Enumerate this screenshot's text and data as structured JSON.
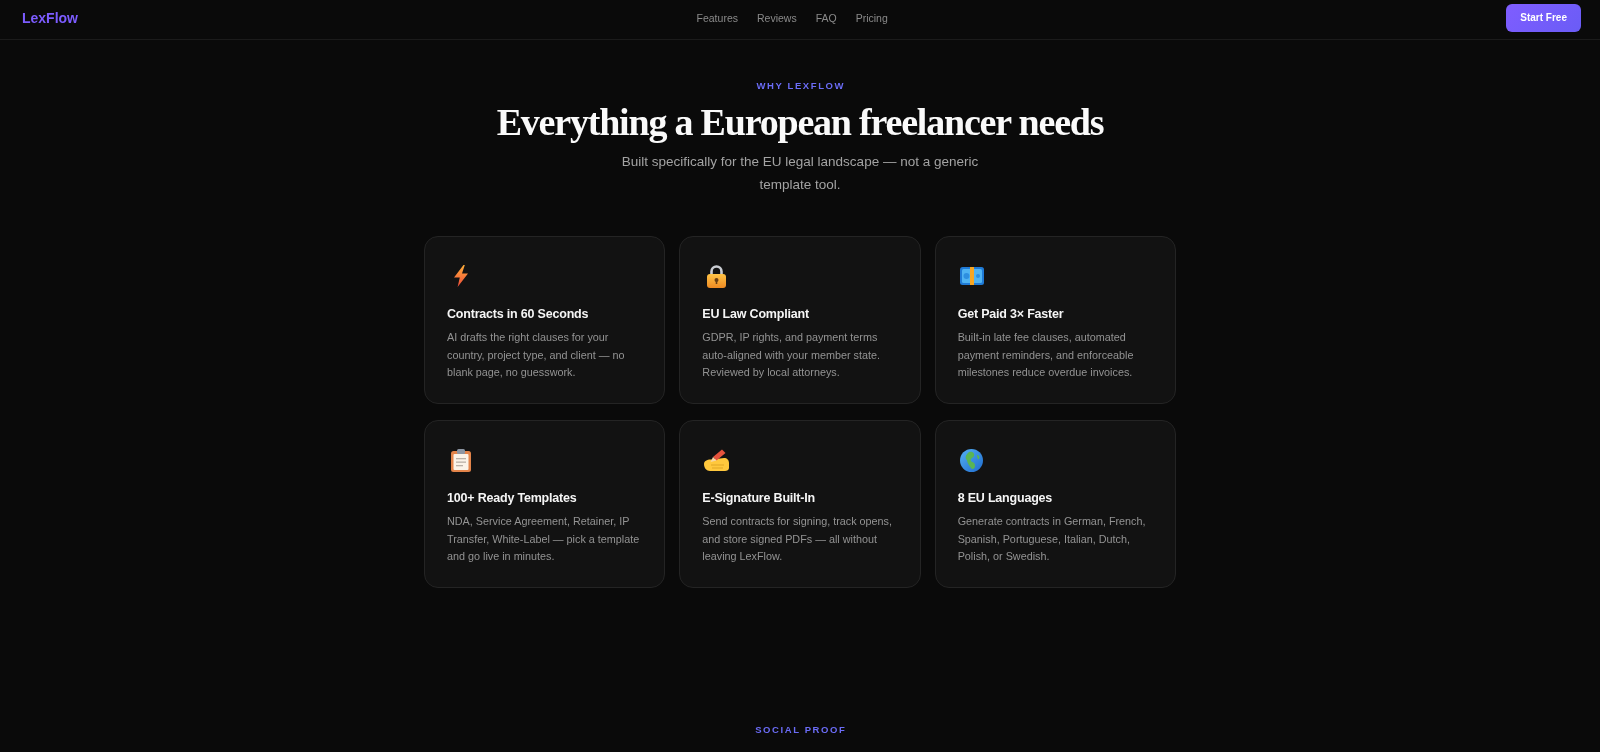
{
  "header": {
    "logo": "LexFlow",
    "nav": [
      "Features",
      "Reviews",
      "FAQ",
      "Pricing"
    ],
    "cta": "Start Free"
  },
  "features_section": {
    "eyebrow": "WHY LEXFLOW",
    "title": "Everything a European freelancer needs",
    "subtitle": "Built specifically for the EU legal landscape — not a generic template tool.",
    "cards": [
      {
        "title": "Contracts in 60 Seconds",
        "description": "AI drafts the right clauses for your country, project type, and client — no blank page, no guesswork."
      },
      {
        "title": "EU Law Compliant",
        "description": "GDPR, IP rights, and payment terms auto-aligned with your member state. Reviewed by local attorneys."
      },
      {
        "title": "Get Paid 3× Faster",
        "description": "Built-in late fee clauses, automated payment reminders, and enforceable milestones reduce overdue invoices."
      },
      {
        "title": "100+ Ready Templates",
        "description": "NDA, Service Agreement, Retainer, IP Transfer, White-Label — pick a template and go live in minutes."
      },
      {
        "title": "E-Signature Built-In",
        "description": "Send contracts for signing, track opens, and store signed PDFs — all without leaving LexFlow."
      },
      {
        "title": "8 EU Languages",
        "description": "Generate contracts in German, French, Spanish, Portuguese, Italian, Dutch, Polish, or Swedish."
      }
    ]
  },
  "next_section": {
    "eyebrow": "SOCIAL PROOF"
  }
}
